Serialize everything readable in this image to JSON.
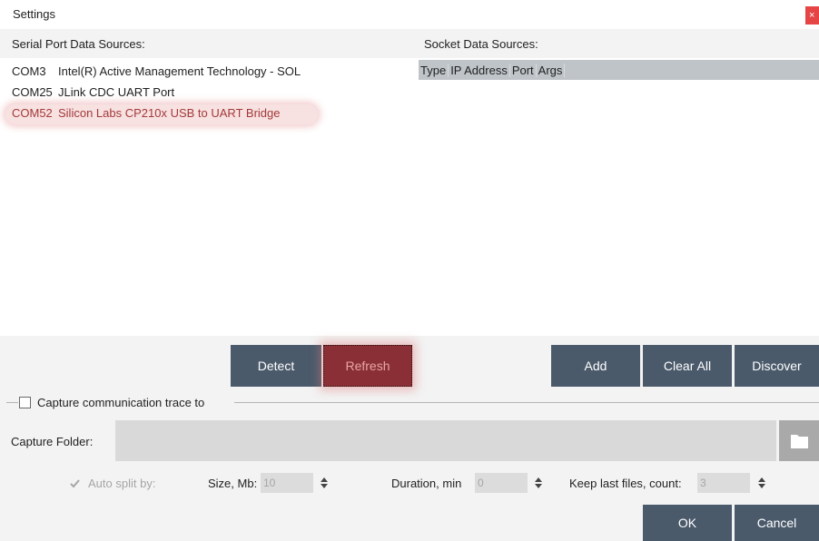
{
  "window": {
    "title": "Settings",
    "close_glyph": "×"
  },
  "serial": {
    "header": "Serial Port Data Sources:",
    "ports": [
      {
        "id": "COM3",
        "name": "Intel(R) Active Management Technology - SOL"
      },
      {
        "id": "COM25",
        "name": "JLink CDC UART Port"
      },
      {
        "id": "COM52",
        "name": "Silicon Labs CP210x USB to UART Bridge",
        "selected": true
      }
    ]
  },
  "socket": {
    "header": "Socket Data Sources:",
    "columns": [
      "Type",
      "IP Address",
      "Port",
      "Args"
    ]
  },
  "buttons": {
    "detect": "Detect",
    "refresh": "Refresh",
    "add": "Add",
    "clear_all": "Clear All",
    "discover": "Discover",
    "ok": "OK",
    "cancel": "Cancel"
  },
  "capture": {
    "group_label": "Capture communication trace to",
    "enabled": false,
    "folder_label": "Capture Folder:",
    "folder_value": "",
    "auto_split_label": "Auto split by:",
    "auto_split_checked": true,
    "size_label": "Size, Mb:",
    "size_value": "10",
    "duration_label": "Duration, min",
    "duration_value": "0",
    "keep_label": "Keep last files, count:",
    "keep_value": "3"
  },
  "icons": {
    "close": "close-icon",
    "folder": "folder-icon",
    "checkmark": "checkmark-icon",
    "spinner": "spinner-arrows-icon"
  },
  "colors": {
    "button": "#4a5a6b",
    "highlight": "#d65a5a",
    "close": "#e64545",
    "panel": "#f3f3f3"
  }
}
